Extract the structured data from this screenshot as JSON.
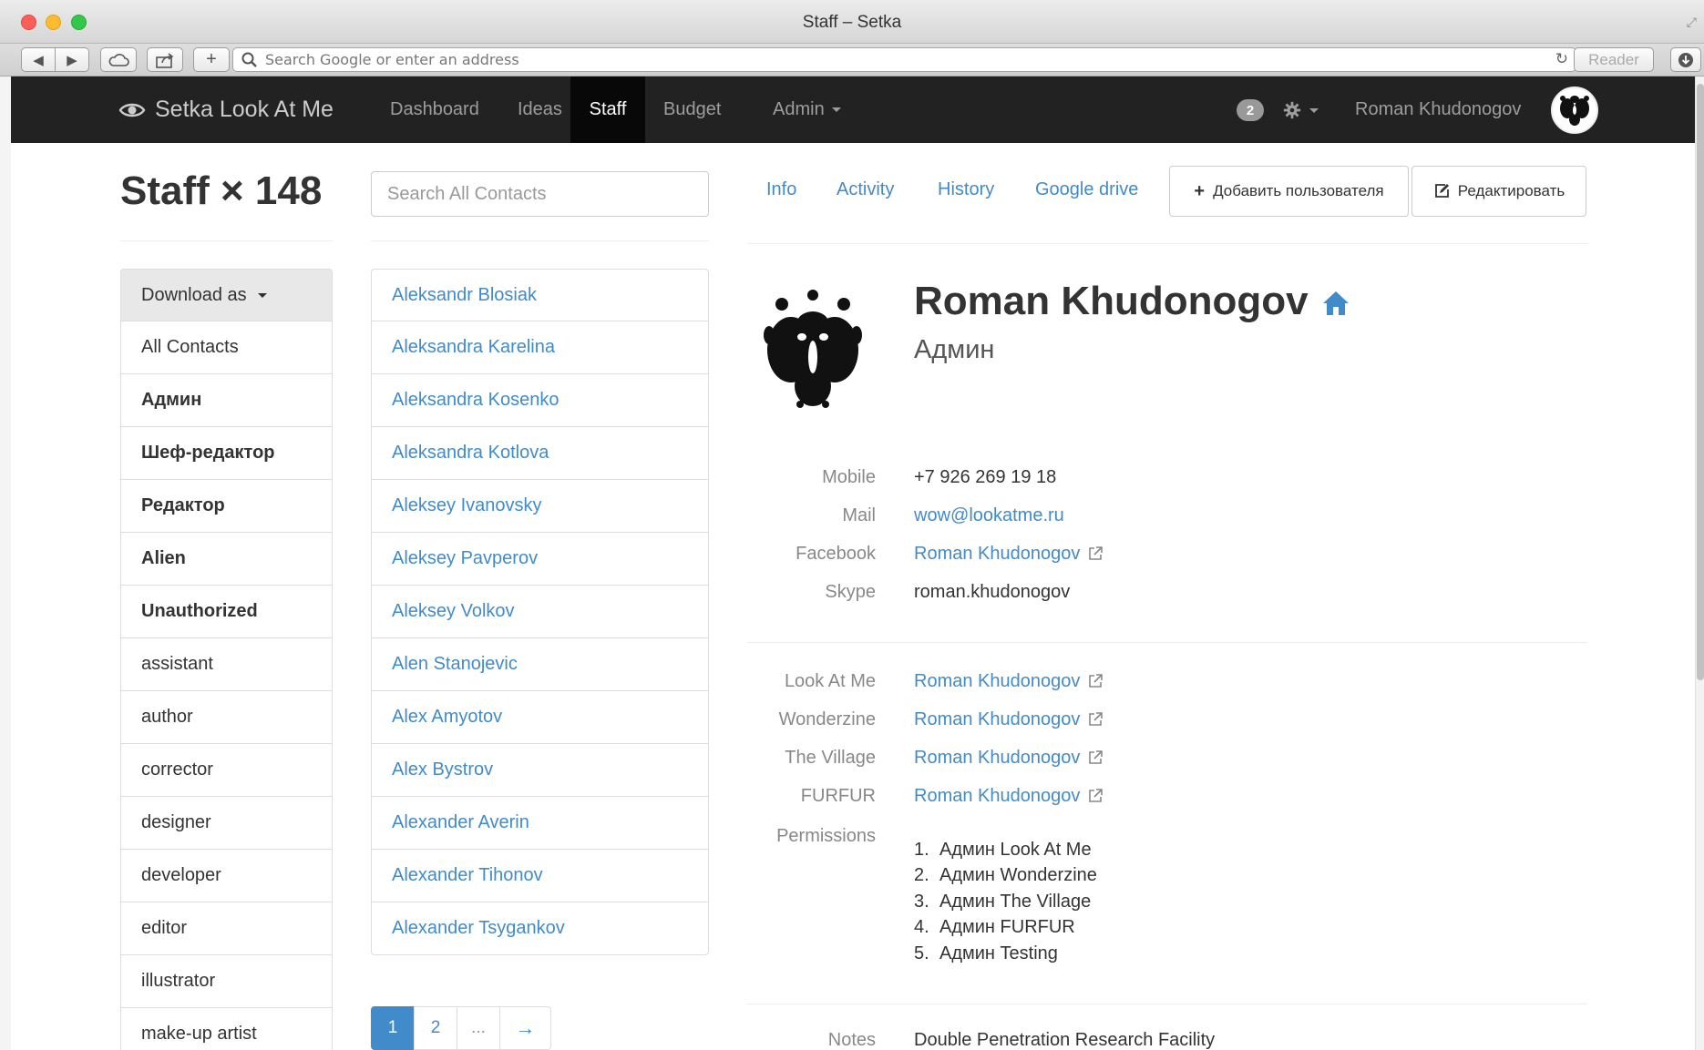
{
  "window": {
    "title": "Staff – Setka",
    "address_placeholder": "Search Google or enter an address",
    "reader_label": "Reader"
  },
  "navbar": {
    "brand": "Setka Look At Me",
    "items": [
      {
        "label": "Dashboard"
      },
      {
        "label": "Ideas"
      },
      {
        "label": "Staff",
        "active": true
      },
      {
        "label": "Budget"
      },
      {
        "label": "Admin"
      }
    ],
    "notification_count": "2",
    "user_name": "Roman Khudonogov"
  },
  "page": {
    "title": "Staff × 148",
    "search_placeholder": "Search All Contacts"
  },
  "tabs": [
    {
      "label": "Info"
    },
    {
      "label": "Activity"
    },
    {
      "label": "History"
    },
    {
      "label": "Google drive"
    }
  ],
  "actions": {
    "add_user": "Добавить пользователя",
    "edit": "Редактировать"
  },
  "roles": [
    {
      "label": "Download as"
    },
    {
      "label": "All Contacts"
    },
    {
      "label": "Админ",
      "bold": true
    },
    {
      "label": "Шеф-редактор",
      "bold": true
    },
    {
      "label": "Редактор",
      "bold": true
    },
    {
      "label": "Alien",
      "bold": true
    },
    {
      "label": "Unauthorized",
      "bold": true
    },
    {
      "label": "assistant"
    },
    {
      "label": "author"
    },
    {
      "label": "corrector"
    },
    {
      "label": "designer"
    },
    {
      "label": "developer"
    },
    {
      "label": "editor"
    },
    {
      "label": "illustrator"
    },
    {
      "label": "make-up artist"
    }
  ],
  "contacts": [
    "Aleksandr Blosiak",
    "Aleksandra Karelina",
    "Aleksandra Kosenko",
    "Aleksandra Kotlova",
    "Aleksey Ivanovsky",
    "Aleksey Pavperov",
    "Aleksey Volkov",
    "Alen Stanojevic",
    "Alex Amyotov",
    "Alex Bystrov",
    "Alexander Averin",
    "Alexander Tihonov",
    "Alexander Tsygankov"
  ],
  "pagination": {
    "pages": [
      "1",
      "2",
      "..."
    ],
    "current": "1",
    "next": "→"
  },
  "profile": {
    "name": "Roman Khudonogov",
    "role": "Админ",
    "contact": [
      {
        "label": "Mobile",
        "value": "+7 926 269 19 18",
        "link": false
      },
      {
        "label": "Mail",
        "value": "wow@lookatme.ru",
        "link": true
      },
      {
        "label": "Facebook",
        "value": "Roman Khudonogov",
        "link": true,
        "external": true
      },
      {
        "label": "Skype",
        "value": "roman.khudonogov",
        "link": false
      }
    ],
    "sites": [
      {
        "label": "Look At Me",
        "value": "Roman Khudonogov"
      },
      {
        "label": "Wonderzine",
        "value": "Roman Khudonogov"
      },
      {
        "label": "The Village",
        "value": "Roman Khudonogov"
      },
      {
        "label": "FURFUR",
        "value": "Roman Khudonogov"
      }
    ],
    "permissions_label": "Permissions",
    "permissions": [
      "Админ Look At Me",
      "Админ Wonderzine",
      "Админ The Village",
      "Админ FURFUR",
      "Админ Testing"
    ],
    "notes_label": "Notes",
    "notes": "Double Penetration Research Facility"
  },
  "colors": {
    "link": "#428bca",
    "navbar_bg": "#222222",
    "navbar_active": "#080808"
  }
}
